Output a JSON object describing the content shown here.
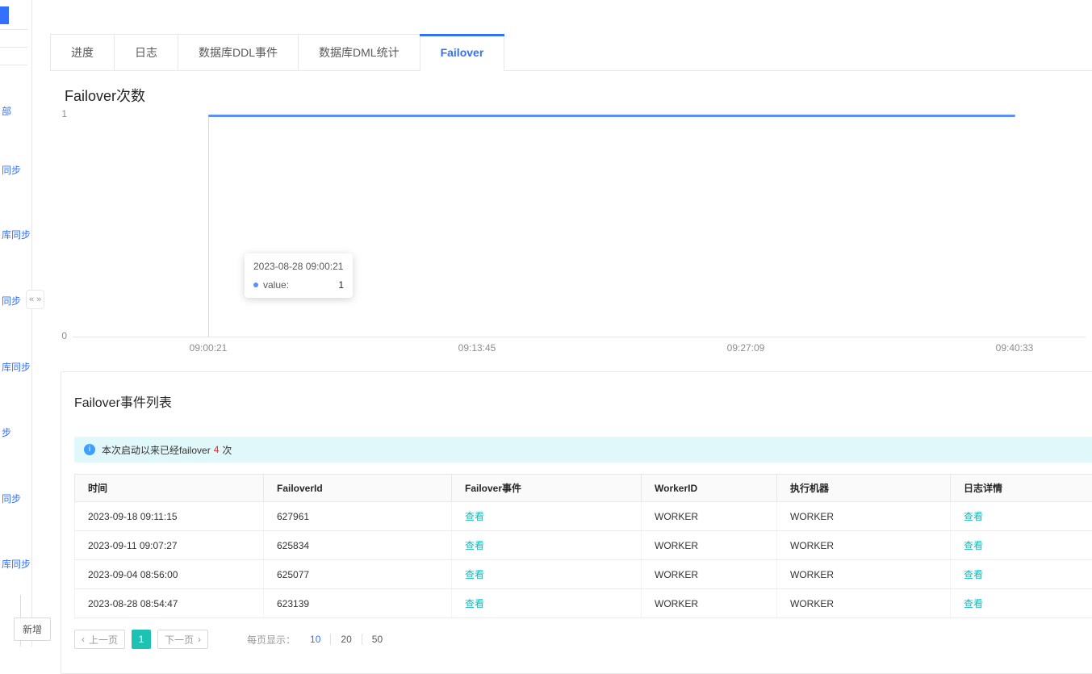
{
  "sidebar": {
    "fragments": [
      "部",
      "同步",
      "库同步",
      "同步",
      "库同步",
      "步",
      "同步",
      "库同步"
    ],
    "new_button_label": "新增"
  },
  "icons": {
    "collapse_left": "«",
    "collapse_right": "»",
    "info": "i",
    "chevron_left": "‹",
    "chevron_right": "›"
  },
  "tabs": {
    "items": [
      {
        "label": "进度"
      },
      {
        "label": "日志"
      },
      {
        "label": "数据库DDL事件"
      },
      {
        "label": "数据库DML统计"
      },
      {
        "label": "Failover"
      }
    ],
    "active": "Failover"
  },
  "chart": {
    "title": "Failover次数",
    "y_ticks": [
      "1",
      "0"
    ],
    "x_ticks": [
      "09:00:21",
      "09:13:45",
      "09:27:09",
      "09:40:33"
    ],
    "tooltip": {
      "timestamp": "2023-08-28 09:00:21",
      "series_label": "value:",
      "value": "1"
    }
  },
  "chart_data": {
    "type": "line",
    "title": "Failover次数",
    "x_ticks": [
      "09:00:21",
      "09:13:45",
      "09:27:09",
      "09:40:33"
    ],
    "ylim": [
      0,
      1
    ],
    "series": [
      {
        "name": "value",
        "points": [
          {
            "x": "09:00:21",
            "y": 1
          },
          {
            "x": "09:40:33",
            "y": 1
          }
        ]
      }
    ],
    "line_color": "#5b8ff9",
    "grid": false,
    "legend": false,
    "tooltip_point": {
      "timestamp": "2023-08-28 09:00:21",
      "value": 1
    }
  },
  "events": {
    "title": "Failover事件列表",
    "alert": {
      "prefix": "本次启动以来已经failover",
      "count": "4",
      "suffix": "次"
    },
    "table": {
      "headers": [
        "时间",
        "FailoverId",
        "Failover事件",
        "WorkerID",
        "执行机器",
        "日志详情"
      ],
      "view_label": "查看",
      "rows": [
        {
          "time": "2023-09-18 09:11:15",
          "failover_id": "627961",
          "worker_id": "WORKER",
          "machine": "WORKER"
        },
        {
          "time": "2023-09-11 09:07:27",
          "failover_id": "625834",
          "worker_id": "WORKER",
          "machine": "WORKER"
        },
        {
          "time": "2023-09-04 08:56:00",
          "failover_id": "625077",
          "worker_id": "WORKER",
          "machine": "WORKER"
        },
        {
          "time": "2023-08-28 08:54:47",
          "failover_id": "623139",
          "worker_id": "WORKER",
          "machine": "WORKER"
        }
      ]
    },
    "pagination": {
      "prev_label": "上一页",
      "next_label": "下一页",
      "current_page": "1",
      "page_size_label": "每页显示：",
      "sizes": [
        "10",
        "20",
        "50"
      ],
      "active_size": "10"
    }
  },
  "colors": {
    "accent_blue": "#3370ff",
    "chart_line_blue": "#5b8ff9",
    "link_teal": "#13b8b8",
    "active_page_teal": "#1ec2b3",
    "alert_count_red": "#f5222d",
    "alert_background": "#e1f8fa"
  }
}
